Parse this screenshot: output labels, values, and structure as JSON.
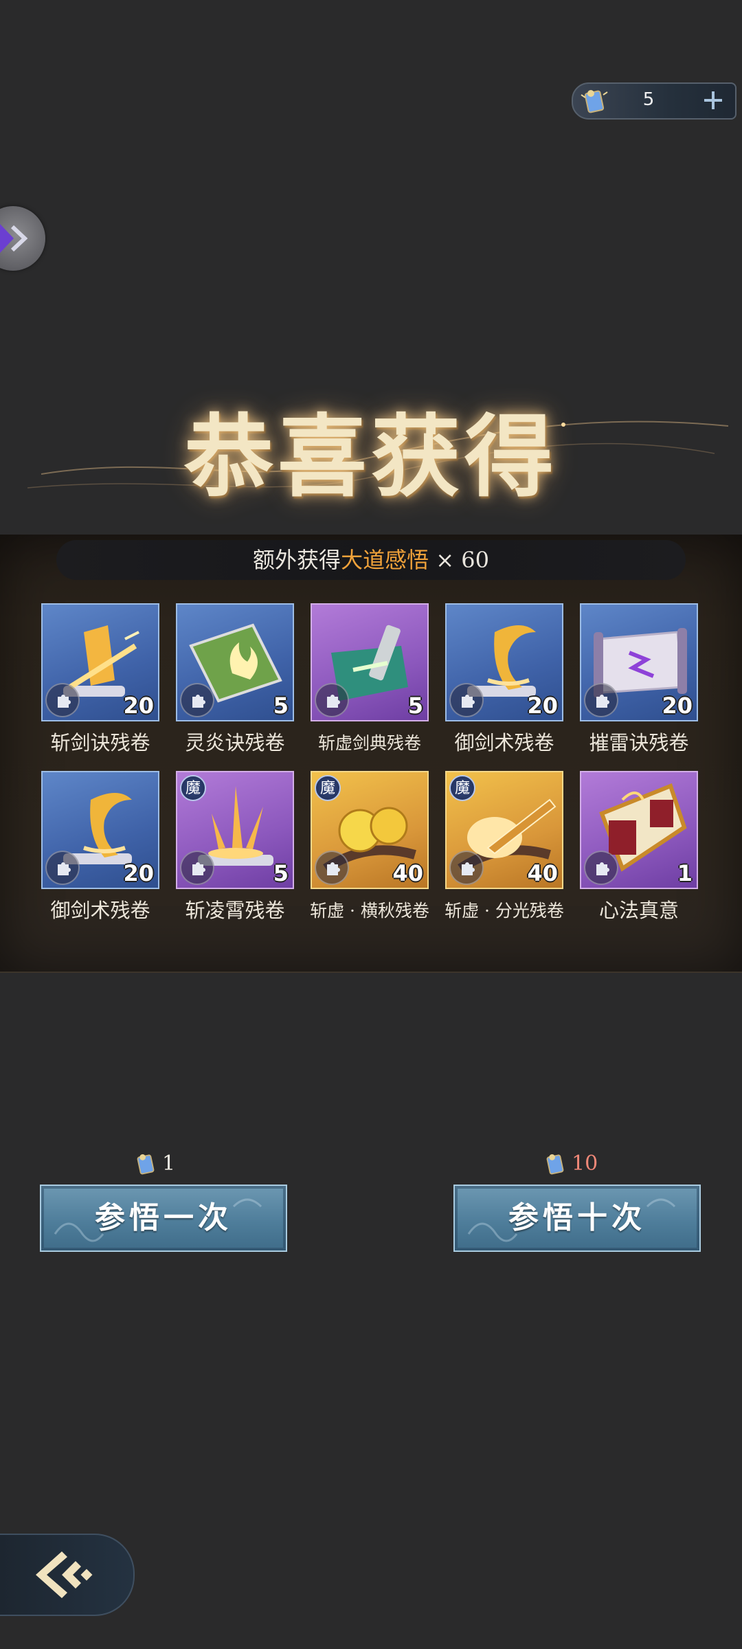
{
  "currency": {
    "value": "5",
    "icon": "scroll-token-icon",
    "plus_icon": "plus-icon"
  },
  "side_button": {
    "icon": "double-chevron-right-icon"
  },
  "title": "恭喜获得",
  "banner": {
    "prefix": "额外获得",
    "highlight": "大道感悟",
    "suffix": "× 60"
  },
  "rewards": [
    {
      "name": "斩剑诀残卷",
      "qty": "20",
      "rarity": "blue",
      "mo": false,
      "icon": "golden-blade-scroll-icon"
    },
    {
      "name": "灵炎诀残卷",
      "qty": "5",
      "rarity": "blue",
      "mo": false,
      "icon": "green-flame-book-icon"
    },
    {
      "name": "斩虚剑典残卷",
      "qty": "5",
      "rarity": "purple",
      "mo": false,
      "icon": "green-cloth-scroll-icon"
    },
    {
      "name": "御剑术残卷",
      "qty": "20",
      "rarity": "blue",
      "mo": false,
      "icon": "golden-hook-scroll-icon"
    },
    {
      "name": "摧雷诀残卷",
      "qty": "20",
      "rarity": "blue",
      "mo": false,
      "icon": "purple-lightning-scroll-icon"
    },
    {
      "name": "御剑术残卷",
      "qty": "20",
      "rarity": "blue",
      "mo": false,
      "icon": "golden-hook-scroll-icon"
    },
    {
      "name": "斩凌霄残卷",
      "qty": "5",
      "rarity": "purple",
      "mo": true,
      "icon": "triple-blade-scroll-icon"
    },
    {
      "name": "斩虚 · 横秋残卷",
      "qty": "40",
      "rarity": "gold",
      "mo": true,
      "icon": "golden-orbs-scroll-icon"
    },
    {
      "name": "斩虚 · 分光残卷",
      "qty": "40",
      "rarity": "gold",
      "mo": true,
      "icon": "sword-flare-scroll-icon"
    },
    {
      "name": "心法真意",
      "qty": "1",
      "rarity": "purple",
      "mo": false,
      "icon": "golden-artifact-icon"
    }
  ],
  "mo_badge": "魔",
  "actions": [
    {
      "label": "参悟一次",
      "cost": "1",
      "cost_color": "#f1ede3"
    },
    {
      "label": "参悟十次",
      "cost": "10",
      "cost_color": "#f08878"
    }
  ],
  "back_button": {
    "icon": "back-arrow-icon"
  }
}
